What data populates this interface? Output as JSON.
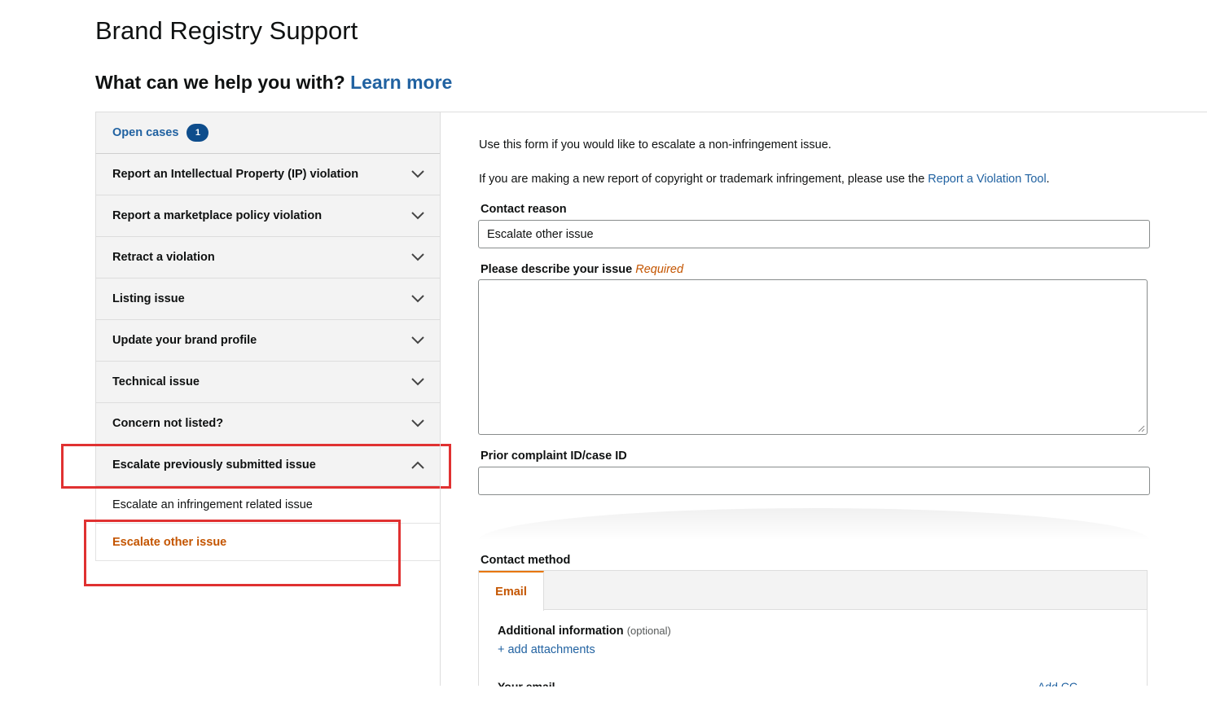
{
  "page": {
    "title": "Brand Registry Support",
    "help_heading": "What can we help you with?",
    "learn_more": "Learn more"
  },
  "sidebar": {
    "open_cases_label": "Open cases",
    "open_cases_count": "1",
    "items": [
      {
        "label": "Report an Intellectual Property (IP) violation",
        "expanded": false
      },
      {
        "label": "Report a marketplace policy violation",
        "expanded": false
      },
      {
        "label": "Retract a violation",
        "expanded": false
      },
      {
        "label": "Listing issue",
        "expanded": false
      },
      {
        "label": "Update your brand profile",
        "expanded": false
      },
      {
        "label": "Technical issue",
        "expanded": false
      },
      {
        "label": "Concern not listed?",
        "expanded": false
      },
      {
        "label": "Escalate previously submitted issue",
        "expanded": true
      }
    ],
    "sub_items": [
      {
        "label": "Escalate an infringement related issue",
        "active": false
      },
      {
        "label": "Escalate other issue",
        "active": true
      }
    ]
  },
  "form": {
    "intro_line1": "Use this form if you would like to escalate a non-infringement issue.",
    "intro_line2_prefix": "If you are making a new report of copyright or trademark infringement, please use the ",
    "intro_line2_link": "Report a Violation Tool",
    "intro_line2_suffix": ".",
    "contact_reason_label": "Contact reason",
    "contact_reason_value": "Escalate other issue",
    "describe_label": "Please describe your issue",
    "required_text": "Required",
    "describe_value": "",
    "prior_id_label": "Prior complaint ID/case ID",
    "prior_id_value": "",
    "contact_method_label": "Contact method",
    "tab_email": "Email",
    "additional_info_label": "Additional information",
    "optional_text": "(optional)",
    "add_attachments": "+ add attachments",
    "cut_left": "Your email",
    "cut_right": "Add CC"
  },
  "colors": {
    "link": "#2162a1",
    "active": "#c45500",
    "badge": "#0e4d8c",
    "highlight": "#e03131",
    "tab_accent": "#e77600"
  }
}
